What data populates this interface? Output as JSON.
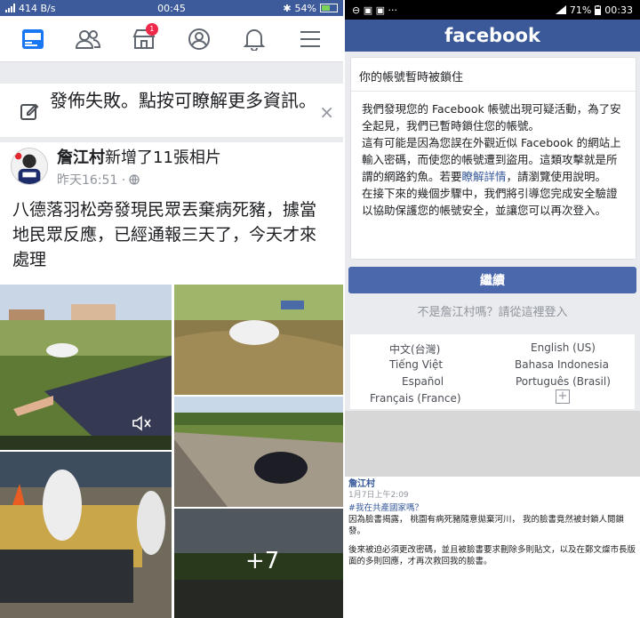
{
  "left_status": {
    "signal": "件ll",
    "speed": "414 B/s",
    "time": "00:45",
    "bluetooth": "✱",
    "battery_text": "54%",
    "battery_level": 0.54
  },
  "nav": {
    "notification_badge": "1"
  },
  "fail_banner": {
    "text": "發佈失敗。點按可瞭解更多資訊。",
    "close": "×"
  },
  "post": {
    "author": "詹江村",
    "title_suffix": "新增了11張相片",
    "time": "昨天16:51 · ",
    "body": "八德落羽松旁發現民眾丟棄病死豬，據當地民眾反應，已經通報三天了，今天才來處理",
    "more_count": "+7"
  },
  "right_status": {
    "icons": "⊖ ▣ ▣ ···",
    "battery_text": "71%",
    "time": "00:33"
  },
  "right_header": {
    "logo": "facebook"
  },
  "lock_card": {
    "title": "你的帳號暫時被鎖住",
    "p1": "我們發現您的 Facebook 帳號出現可疑活動，為了安全起見，我們已暫時鎖住您的帳號。",
    "p2_a": "這有可能是因為您誤在外觀近似 Facebook 的網站上輸入密碼，而使您的帳號遭到盜用。這類攻擊就是所謂的網路釣魚。若要",
    "p2_link": "瞭解詳情",
    "p2_b": "，請瀏覽使用說明。",
    "p3": "在接下來的幾個步驟中，我們將引導您完成安全驗證以協助保護您的帳號安全，並讓您可以再次登入。"
  },
  "continue_button": "繼續",
  "not_user": "不是詹江村嗎？請從這裡登入",
  "languages": [
    "中文(台灣)",
    "English (US)",
    "Tiếng Việt",
    "Bahasa Indonesia",
    "Español",
    "Português (Brasil)",
    "Français (France)"
  ],
  "language_plus": "+",
  "note": {
    "name": "詹江村",
    "time": "1月7日上午2:09",
    "tag": "#我在共產國家嗎？",
    "line1": "因為臉書揭露， 桃園有病死豬隨意拋棄河川， 我的臉書竟然被封鎖人閱鎖發。",
    "line2": "後來被迫必須更改密碼，並且被臉書要求刪除多則貼文，以及在鄭文燦市長版面的多則回應，才再次救回我的臉書。"
  },
  "colors": {
    "fb_blue": "#3b5998",
    "button_blue": "#4b68ad",
    "badge_red": "#f02849",
    "link": "#365899"
  }
}
